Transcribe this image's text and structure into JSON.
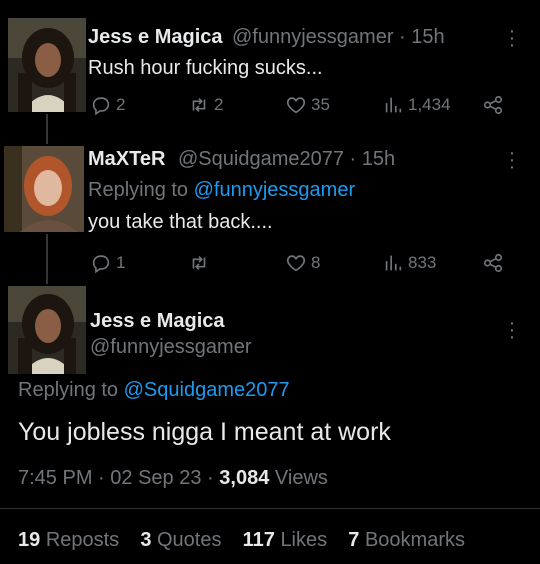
{
  "tweet1": {
    "author_name": "Jess e Magica",
    "handle": "@funnyjessgamer",
    "separator": "·",
    "time": "15h",
    "text": "Rush hour fucking sucks...",
    "replies": "2",
    "reposts": "2",
    "likes": "35",
    "views": "1,434"
  },
  "tweet2": {
    "author_name": "MaXTeR",
    "handle": "@Squidgame2077",
    "separator": "·",
    "time": "15h",
    "replying_label": "Replying to",
    "replying_to": "@funnyjessgamer",
    "text": "you take that back....",
    "replies": "1",
    "reposts": "",
    "likes": "8",
    "views": "833"
  },
  "main": {
    "author_name": "Jess e Magica",
    "handle": "@funnyjessgamer",
    "replying_label": "Replying to",
    "replying_to": "@Squidgame2077",
    "text": "You jobless nigga I meant at work",
    "time": "7:45 PM",
    "sep1": "·",
    "date": "02 Sep 23",
    "sep2": "·",
    "views_count": "3,084",
    "views_label": "Views",
    "stats": {
      "reposts_count": "19",
      "reposts_label": "Reposts",
      "quotes_count": "3",
      "quotes_label": "Quotes",
      "likes_count": "117",
      "likes_label": "Likes",
      "bookmarks_count": "7",
      "bookmarks_label": "Bookmarks"
    }
  },
  "icons": {
    "reply": "reply-icon",
    "repost": "repost-icon",
    "like": "heart-icon",
    "views": "views-icon",
    "share": "share-icon",
    "more": "more-icon"
  },
  "colors": {
    "background": "#000000",
    "text": "#e7e9ea",
    "muted": "#71767b",
    "link": "#1d9bf0"
  }
}
